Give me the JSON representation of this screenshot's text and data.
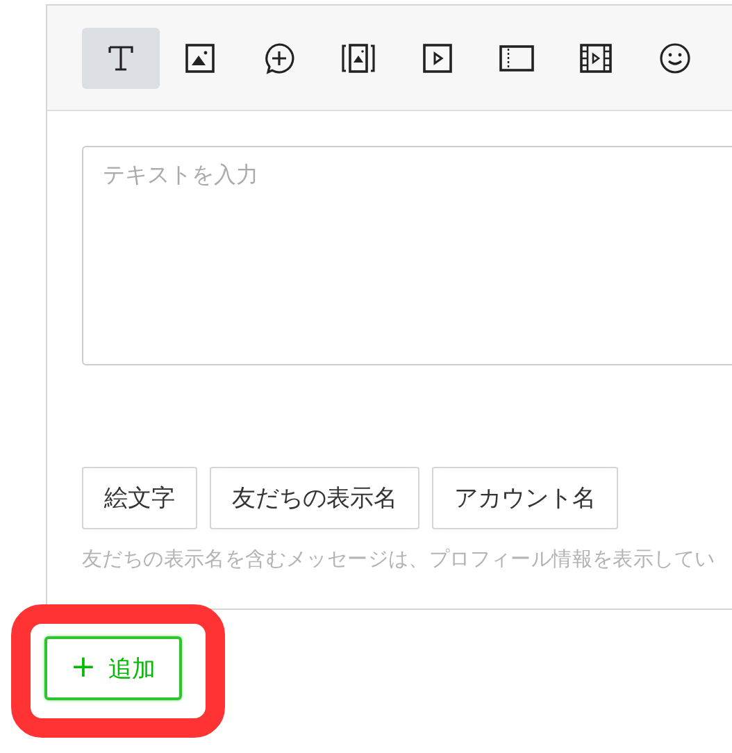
{
  "toolbar": {
    "tools": [
      {
        "kind": "text",
        "selected": true
      },
      {
        "kind": "image",
        "selected": false
      },
      {
        "kind": "bubble",
        "selected": false
      },
      {
        "kind": "carousel",
        "selected": false
      },
      {
        "kind": "video",
        "selected": false
      },
      {
        "kind": "coupon",
        "selected": false
      },
      {
        "kind": "film",
        "selected": false
      },
      {
        "kind": "emoji",
        "selected": false
      }
    ]
  },
  "message": {
    "placeholder": "テキストを入力"
  },
  "insert_buttons": [
    "絵文字",
    "友だちの表示名",
    "アカウント名"
  ],
  "hint": "友だちの表示名を含むメッセージは、プロフィール情報を表示してい",
  "add_button": {
    "icon": "+",
    "label": "追加",
    "highlighted": true
  }
}
